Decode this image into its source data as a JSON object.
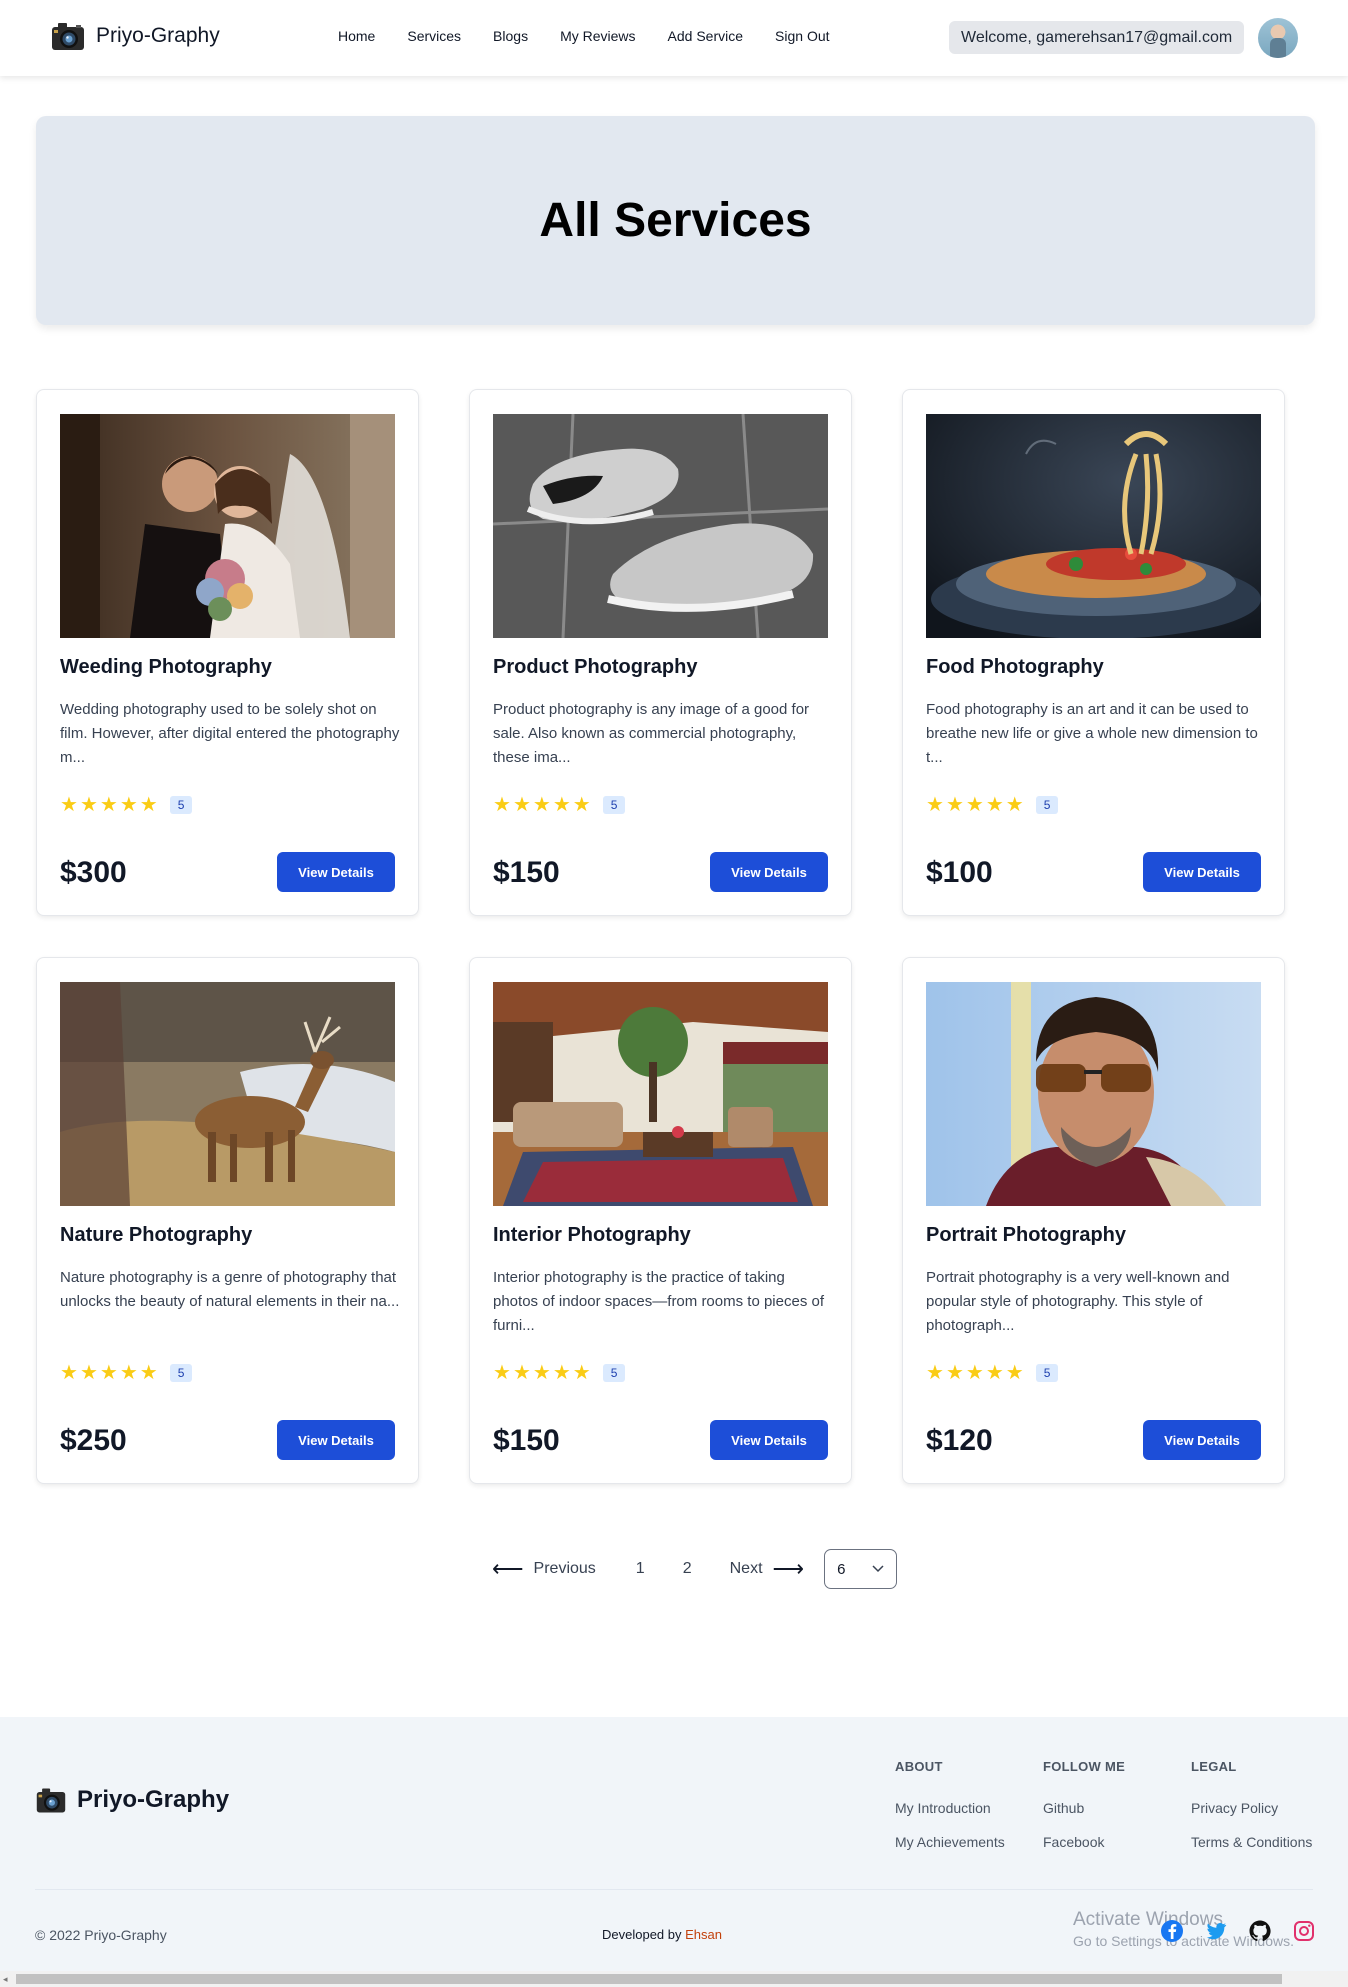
{
  "nav": {
    "brand": "Priyo-Graphy",
    "links": [
      "Home",
      "Services",
      "Blogs",
      "My Reviews",
      "Add Service",
      "Sign Out"
    ],
    "welcome": "Welcome, gamerehsan17@gmail.com"
  },
  "hero": {
    "title": "All Services"
  },
  "services": [
    {
      "title": "Weeding Photography",
      "desc": "Wedding photography used to be solely shot on film. However, after digital entered the photography m...",
      "rating": "5",
      "price": "$300",
      "button": "View Details",
      "image": "wedding-couple-image"
    },
    {
      "title": "Product Photography",
      "desc": "Product photography is any image of a good for sale. Also known as commercial photography, these ima...",
      "rating": "5",
      "price": "$150",
      "button": "View Details",
      "image": "sneakers-image"
    },
    {
      "title": "Food Photography",
      "desc": "Food photography is an art and it can be used to breathe new life or give a whole new dimension to t...",
      "rating": "5",
      "price": "$100",
      "button": "View Details",
      "image": "pasta-image"
    },
    {
      "title": "Nature Photography",
      "desc": "Nature photography is a genre of photography that unlocks the beauty of natural elements in their na...",
      "rating": "5",
      "price": "$250",
      "button": "View Details",
      "image": "deer-image"
    },
    {
      "title": "Interior Photography",
      "desc": "Interior photography is the practice of taking photos of indoor spaces—from rooms to pieces of furni...",
      "rating": "5",
      "price": "$150",
      "button": "View Details",
      "image": "living-room-image"
    },
    {
      "title": "Portrait Photography",
      "desc": "Portrait photography is a very well-known and popular style of photography. This style of photograph...",
      "rating": "5",
      "price": "$120",
      "button": "View Details",
      "image": "portrait-man-image"
    }
  ],
  "pagination": {
    "previous": "Previous",
    "pages": [
      "1",
      "2"
    ],
    "next": "Next",
    "per_page": "6"
  },
  "footer": {
    "brand": "Priyo-Graphy",
    "about": {
      "heading": "ABOUT",
      "links": [
        "My Introduction",
        "My Achievements"
      ]
    },
    "follow": {
      "heading": "FOLLOW ME",
      "links": [
        "Github",
        "Facebook"
      ]
    },
    "legal": {
      "heading": "LEGAL",
      "links": [
        "Privacy Policy",
        "Terms & Conditions"
      ]
    },
    "copyright": "© 2022 Priyo-Graphy",
    "developed_prefix": "Developed by",
    "developer": "Ehsan",
    "watermark_line1": "Activate Windows",
    "watermark_line2": "Go to Settings to activate Windows."
  },
  "colors": {
    "primary": "#1d4ed8",
    "star": "#facc15",
    "hero_bg": "#e2e8f0",
    "footer_bg": "#f1f5f9",
    "developer_accent": "#c2410c"
  }
}
